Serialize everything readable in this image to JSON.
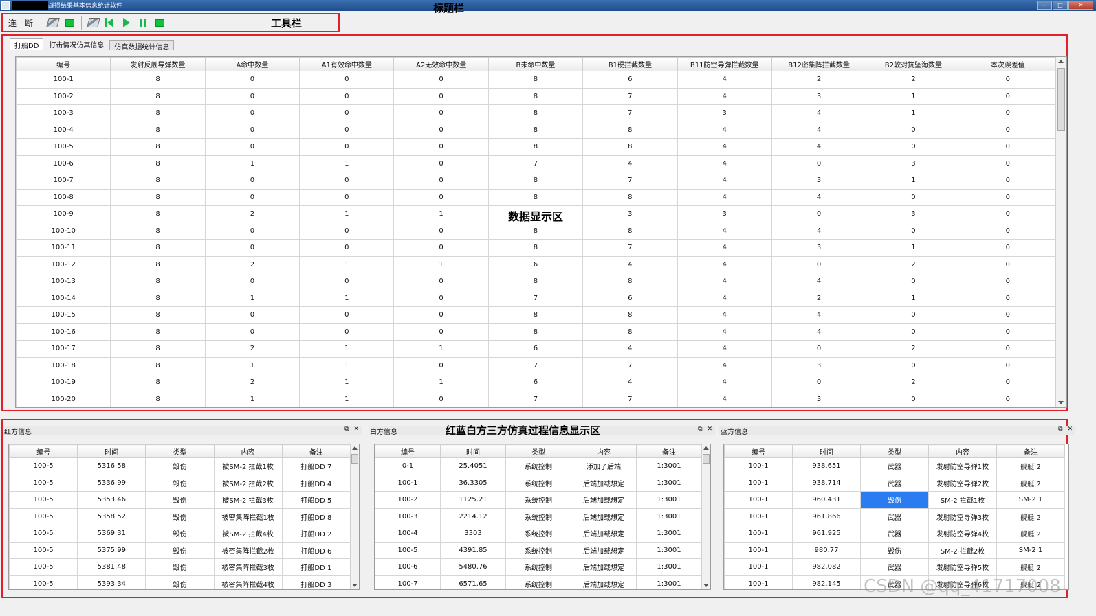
{
  "window": {
    "title": "战损结果基本信息统计软件",
    "buttons": [
      "—",
      "□",
      "✕"
    ]
  },
  "annotations": {
    "title_bar": "标题栏",
    "toolbar": "工具栏",
    "data_area": "数据显示区",
    "process_area": "红蓝白方三方仿真过程信息显示区"
  },
  "toolbar": {
    "connect_label": "连",
    "disconnect_label": "断",
    "icons": [
      "edit-icon",
      "green-square-icon",
      "edit-icon",
      "skip-back-icon",
      "play-icon",
      "pause-icon",
      "green-square-icon"
    ]
  },
  "tabs": [
    "打船DD",
    "打击情况仿真信息",
    "仿真数据统计信息"
  ],
  "main_table": {
    "columns": [
      "编号",
      "发射反舰导弹数量",
      "A命中数量",
      "A1有效命中数量",
      "A2无效命中数量",
      "B未命中数量",
      "B1硬拦截数量",
      "B11防空导弹拦截数量",
      "B12密集阵拦截数量",
      "B2软对抗坠海数量",
      "本次误差值"
    ],
    "rows": [
      [
        "100-1",
        "8",
        "0",
        "0",
        "0",
        "8",
        "6",
        "4",
        "2",
        "2",
        "0"
      ],
      [
        "100-2",
        "8",
        "0",
        "0",
        "0",
        "8",
        "7",
        "4",
        "3",
        "1",
        "0"
      ],
      [
        "100-3",
        "8",
        "0",
        "0",
        "0",
        "8",
        "7",
        "3",
        "4",
        "1",
        "0"
      ],
      [
        "100-4",
        "8",
        "0",
        "0",
        "0",
        "8",
        "8",
        "4",
        "4",
        "0",
        "0"
      ],
      [
        "100-5",
        "8",
        "0",
        "0",
        "0",
        "8",
        "8",
        "4",
        "4",
        "0",
        "0"
      ],
      [
        "100-6",
        "8",
        "1",
        "1",
        "0",
        "7",
        "4",
        "4",
        "0",
        "3",
        "0"
      ],
      [
        "100-7",
        "8",
        "0",
        "0",
        "0",
        "8",
        "7",
        "4",
        "3",
        "1",
        "0"
      ],
      [
        "100-8",
        "8",
        "0",
        "0",
        "0",
        "8",
        "8",
        "4",
        "4",
        "0",
        "0"
      ],
      [
        "100-9",
        "8",
        "2",
        "1",
        "1",
        "",
        "3",
        "3",
        "0",
        "3",
        "0"
      ],
      [
        "100-10",
        "8",
        "0",
        "0",
        "0",
        "8",
        "8",
        "4",
        "4",
        "0",
        "0"
      ],
      [
        "100-11",
        "8",
        "0",
        "0",
        "0",
        "8",
        "7",
        "4",
        "3",
        "1",
        "0"
      ],
      [
        "100-12",
        "8",
        "2",
        "1",
        "1",
        "6",
        "4",
        "4",
        "0",
        "2",
        "0"
      ],
      [
        "100-13",
        "8",
        "0",
        "0",
        "0",
        "8",
        "8",
        "4",
        "4",
        "0",
        "0"
      ],
      [
        "100-14",
        "8",
        "1",
        "1",
        "0",
        "7",
        "6",
        "4",
        "2",
        "1",
        "0"
      ],
      [
        "100-15",
        "8",
        "0",
        "0",
        "0",
        "8",
        "8",
        "4",
        "4",
        "0",
        "0"
      ],
      [
        "100-16",
        "8",
        "0",
        "0",
        "0",
        "8",
        "8",
        "4",
        "4",
        "0",
        "0"
      ],
      [
        "100-17",
        "8",
        "2",
        "1",
        "1",
        "6",
        "4",
        "4",
        "0",
        "2",
        "0"
      ],
      [
        "100-18",
        "8",
        "1",
        "1",
        "0",
        "7",
        "7",
        "4",
        "3",
        "0",
        "0"
      ],
      [
        "100-19",
        "8",
        "2",
        "1",
        "1",
        "6",
        "4",
        "4",
        "0",
        "2",
        "0"
      ],
      [
        "100-20",
        "8",
        "1",
        "1",
        "0",
        "7",
        "7",
        "4",
        "3",
        "0",
        "0"
      ]
    ]
  },
  "panels": {
    "red": {
      "title": "红方信息",
      "columns": [
        "编号",
        "时间",
        "类型",
        "内容",
        "备注"
      ],
      "rows": [
        [
          "100-5",
          "5316.58",
          "毁伤",
          "被SM-2 拦截1枚",
          "打船DD  7"
        ],
        [
          "100-5",
          "5336.99",
          "毁伤",
          "被SM-2 拦截2枚",
          "打船DD  4"
        ],
        [
          "100-5",
          "5353.46",
          "毁伤",
          "被SM-2 拦截3枚",
          "打船DD  5"
        ],
        [
          "100-5",
          "5358.52",
          "毁伤",
          "被密集阵拦截1枚",
          "打船DD  8"
        ],
        [
          "100-5",
          "5369.31",
          "毁伤",
          "被SM-2 拦截4枚",
          "打船DD  2"
        ],
        [
          "100-5",
          "5375.99",
          "毁伤",
          "被密集阵拦截2枚",
          "打船DD  6"
        ],
        [
          "100-5",
          "5381.48",
          "毁伤",
          "被密集阵拦截3枚",
          "打船DD  1"
        ],
        [
          "100-5",
          "5393.34",
          "毁伤",
          "被密集阵拦截4枚",
          "打船DD  3"
        ]
      ]
    },
    "white": {
      "title": "白方信息",
      "columns": [
        "编号",
        "时间",
        "类型",
        "内容",
        "备注"
      ],
      "rows": [
        [
          "0-1",
          "25.4051",
          "系统控制",
          "添加了后端",
          "1:3001"
        ],
        [
          "100-1",
          "36.3305",
          "系统控制",
          "后端加载想定",
          "1:3001"
        ],
        [
          "100-2",
          "1125.21",
          "系统控制",
          "后端加载想定",
          "1:3001"
        ],
        [
          "100-3",
          "2214.12",
          "系统控制",
          "后端加载想定",
          "1:3001"
        ],
        [
          "100-4",
          "3303",
          "系统控制",
          "后端加载想定",
          "1:3001"
        ],
        [
          "100-5",
          "4391.85",
          "系统控制",
          "后端加载想定",
          "1:3001"
        ],
        [
          "100-6",
          "5480.76",
          "系统控制",
          "后端加载想定",
          "1:3001"
        ],
        [
          "100-7",
          "6571.65",
          "系统控制",
          "后端加载想定",
          "1:3001"
        ]
      ]
    },
    "blue": {
      "title": "蓝方信息",
      "columns": [
        "编号",
        "时间",
        "类型",
        "内容",
        "备注"
      ],
      "rows": [
        [
          "100-1",
          "938.651",
          "武器",
          "发射防空导弹1枚",
          "舰艇    2"
        ],
        [
          "100-1",
          "938.714",
          "武器",
          "发射防空导弹2枚",
          "舰艇    2"
        ],
        [
          "100-1",
          "960.431",
          "毁伤",
          "SM-2 拦截1枚",
          "SM-2 1"
        ],
        [
          "100-1",
          "961.866",
          "武器",
          "发射防空导弹3枚",
          "舰艇    2"
        ],
        [
          "100-1",
          "961.925",
          "武器",
          "发射防空导弹4枚",
          "舰艇    2"
        ],
        [
          "100-1",
          "980.77",
          "毁伤",
          "SM-2 拦截2枚",
          "SM-2 1"
        ],
        [
          "100-1",
          "982.082",
          "武器",
          "发射防空导弹5枚",
          "舰艇    2"
        ],
        [
          "100-1",
          "982.145",
          "武器",
          "发射防空导弹6枚",
          "舰艇    2"
        ]
      ],
      "selected_cell": {
        "row": 2,
        "column": "类型"
      }
    },
    "float_icon": "restore-icon",
    "close_icon": "close-icon"
  },
  "watermark": "CSDN @qq_41717008"
}
